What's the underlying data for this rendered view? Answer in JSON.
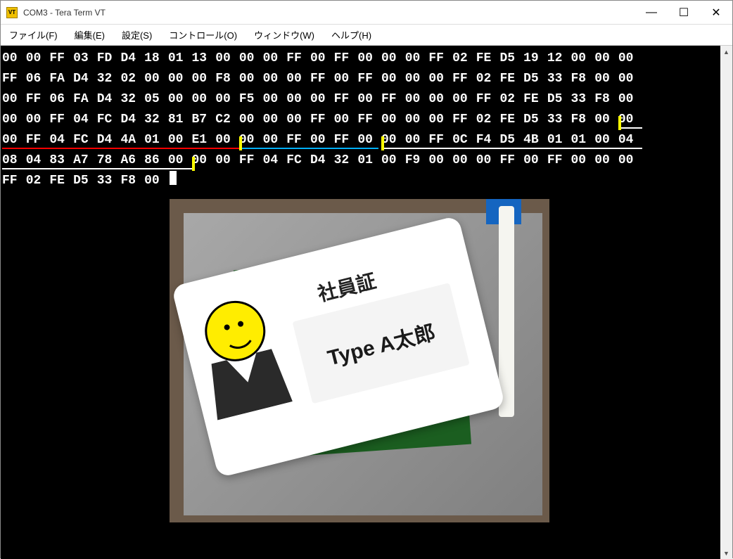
{
  "window": {
    "title": "COM3 - Tera Term VT",
    "icon_label": "VT"
  },
  "menu": {
    "file": "ファイル(F)",
    "edit": "編集(E)",
    "setup": "設定(S)",
    "control": "コントロール(O)",
    "window": "ウィンドウ(W)",
    "help": "ヘルプ(H)"
  },
  "hex_rows": [
    [
      "00",
      "00",
      "FF",
      "03",
      "FD",
      "D4",
      "18",
      "01",
      "13",
      "00",
      "00",
      "00",
      "FF",
      "00",
      "FF",
      "00",
      "00",
      "00",
      "FF",
      "02",
      "FE",
      "D5",
      "19",
      "12",
      "00",
      "00",
      "00"
    ],
    [
      "FF",
      "06",
      "FA",
      "D4",
      "32",
      "02",
      "00",
      "00",
      "00",
      "F8",
      "00",
      "00",
      "00",
      "FF",
      "00",
      "FF",
      "00",
      "00",
      "00",
      "FF",
      "02",
      "FE",
      "D5",
      "33",
      "F8",
      "00",
      "00"
    ],
    [
      "00",
      "FF",
      "06",
      "FA",
      "D4",
      "32",
      "05",
      "00",
      "00",
      "00",
      "F5",
      "00",
      "00",
      "00",
      "FF",
      "00",
      "FF",
      "00",
      "00",
      "00",
      "FF",
      "02",
      "FE",
      "D5",
      "33",
      "F8",
      "00"
    ],
    [
      "00",
      "00",
      "FF",
      "04",
      "FC",
      "D4",
      "32",
      "81",
      "B7",
      "C2",
      "00",
      "00",
      "00",
      "FF",
      "00",
      "FF",
      "00",
      "00",
      "00",
      "FF",
      "02",
      "FE",
      "D5",
      "33",
      "F8",
      "00",
      "00"
    ],
    [
      "00",
      "FF",
      "04",
      "FC",
      "D4",
      "4A",
      "01",
      "00",
      "E1",
      "00",
      "00",
      "00",
      "FF",
      "00",
      "FF",
      "00",
      "00",
      "00",
      "FF",
      "0C",
      "F4",
      "D5",
      "4B",
      "01",
      "01",
      "00",
      "04"
    ],
    [
      "08",
      "04",
      "83",
      "A7",
      "78",
      "A6",
      "86",
      "00",
      "00",
      "00",
      "FF",
      "04",
      "FC",
      "D4",
      "32",
      "01",
      "00",
      "F9",
      "00",
      "00",
      "00",
      "FF",
      "00",
      "FF",
      "00",
      "00",
      "00"
    ],
    [
      "FF",
      "02",
      "FE",
      "D5",
      "33",
      "F8",
      "00"
    ]
  ],
  "card": {
    "label": "社員証",
    "name": "Type A太郎"
  },
  "icons": {
    "smiley": "smiley-face-icon",
    "minimize": "—",
    "maximize": "☐",
    "close": "✕",
    "up": "▲",
    "down": "▼"
  }
}
